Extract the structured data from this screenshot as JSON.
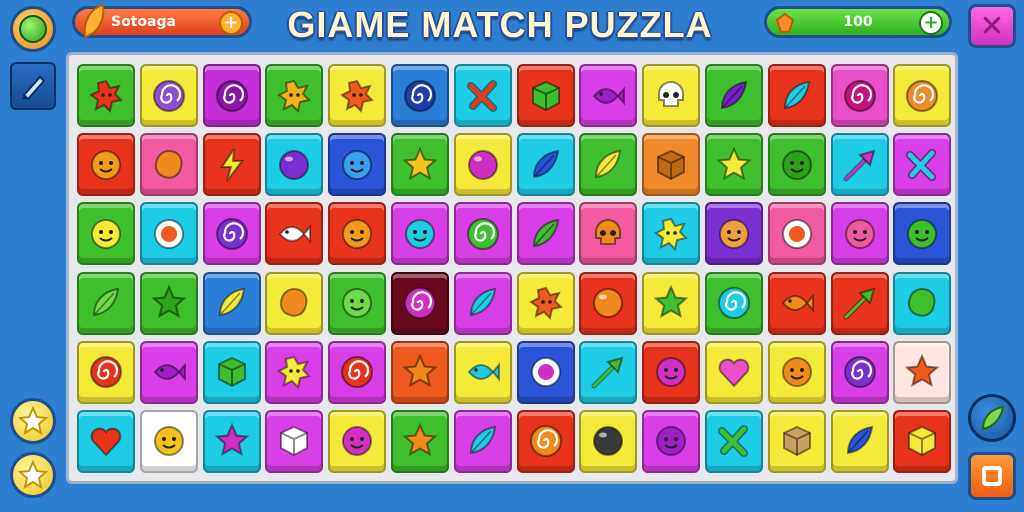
{
  "header": {
    "title": "GIAME MATCH PUZZLA",
    "score_label": "Sotoaga",
    "coins_value": "100",
    "plus_symbol": "+",
    "close_symbol": "✕"
  },
  "colors": {
    "background": "#2f7fd0",
    "board": "#e6e8ec"
  },
  "board": {
    "rows": [
      [
        {
          "bg": "#3fbf2e",
          "icon": "red-splat",
          "fg": "#e8331c"
        },
        {
          "bg": "#f4ea3a",
          "icon": "swirl",
          "fg": "#8d4fd1"
        },
        {
          "bg": "#c42fd8",
          "icon": "swirl",
          "fg": "#8b15a8"
        },
        {
          "bg": "#3fbf2e",
          "icon": "splat",
          "fg": "#f3b01c"
        },
        {
          "bg": "#f4ea3a",
          "icon": "splat",
          "fg": "#ef5a1e"
        },
        {
          "bg": "#2b7fd8",
          "icon": "swirl",
          "fg": "#1d3fa8"
        },
        {
          "bg": "#1ecce6",
          "icon": "cross",
          "fg": "#e23b1c"
        },
        {
          "bg": "#e8331c",
          "icon": "cube",
          "fg": "#3cbf2e"
        },
        {
          "bg": "#d93fe6",
          "icon": "fish",
          "fg": "#a020c8"
        },
        {
          "bg": "#f4ea3a",
          "icon": "skull",
          "fg": "#ffffff"
        },
        {
          "bg": "#3fbf2e",
          "icon": "leaf",
          "fg": "#7b22c6"
        },
        {
          "bg": "#e8331c",
          "icon": "leaf",
          "fg": "#1ecce6"
        },
        {
          "bg": "#e84fc8",
          "icon": "swirl",
          "fg": "#c2127e"
        },
        {
          "bg": "#f4ea3a",
          "icon": "swirl",
          "fg": "#ef8a2a"
        }
      ],
      [
        {
          "bg": "#e8331c",
          "icon": "face",
          "fg": "#f39a1c"
        },
        {
          "bg": "#f15a9e",
          "icon": "blob",
          "fg": "#f08a1c"
        },
        {
          "bg": "#e8331c",
          "icon": "bolt",
          "fg": "#f4ea3a"
        },
        {
          "bg": "#1ecce6",
          "icon": "orb",
          "fg": "#7a2fd0"
        },
        {
          "bg": "#2b55d8",
          "icon": "face",
          "fg": "#3aa0f0"
        },
        {
          "bg": "#3fbf2e",
          "icon": "star",
          "fg": "#f4c21c"
        },
        {
          "bg": "#f4ea3a",
          "icon": "orb",
          "fg": "#d02fc2"
        },
        {
          "bg": "#1ecce6",
          "icon": "leaf",
          "fg": "#2b55d8"
        },
        {
          "bg": "#3fbf2e",
          "icon": "leaf",
          "fg": "#f4ea3a"
        },
        {
          "bg": "#ef8a2a",
          "icon": "cube",
          "fg": "#c06a14"
        },
        {
          "bg": "#3fbf2e",
          "icon": "star",
          "fg": "#f4ea3a"
        },
        {
          "bg": "#3fbf2e",
          "icon": "face",
          "fg": "#2ea01c"
        },
        {
          "bg": "#1ecce6",
          "icon": "arrow",
          "fg": "#d02fc2"
        },
        {
          "bg": "#d93fe6",
          "icon": "cross",
          "fg": "#1ecce6"
        }
      ],
      [
        {
          "bg": "#3fbf2e",
          "icon": "face",
          "fg": "#f4ea3a"
        },
        {
          "bg": "#1ecce6",
          "icon": "ring",
          "fg": "#ef5a1e"
        },
        {
          "bg": "#d93fe6",
          "icon": "swirl",
          "fg": "#7a2fd0"
        },
        {
          "bg": "#e8331c",
          "icon": "fish",
          "fg": "#ffffff"
        },
        {
          "bg": "#e8331c",
          "icon": "face",
          "fg": "#f39a1c"
        },
        {
          "bg": "#d93fe6",
          "icon": "face",
          "fg": "#1ecce6"
        },
        {
          "bg": "#d93fe6",
          "icon": "swirl",
          "fg": "#3fbf2e"
        },
        {
          "bg": "#d93fe6",
          "icon": "leaf",
          "fg": "#3fbf2e"
        },
        {
          "bg": "#f15a9e",
          "icon": "skull",
          "fg": "#f08a1c"
        },
        {
          "bg": "#1ecce6",
          "icon": "splat",
          "fg": "#f4ea3a"
        },
        {
          "bg": "#7a2fd0",
          "icon": "face",
          "fg": "#f0a040"
        },
        {
          "bg": "#f15a9e",
          "icon": "ring",
          "fg": "#ef5a1e"
        },
        {
          "bg": "#d93fe6",
          "icon": "face",
          "fg": "#f15a9e"
        },
        {
          "bg": "#2b55d8",
          "icon": "face",
          "fg": "#3fbf2e"
        }
      ],
      [
        {
          "bg": "#3fbf2e",
          "icon": "leaf",
          "fg": "#6cd84a"
        },
        {
          "bg": "#3fbf2e",
          "icon": "star",
          "fg": "#2ea01c"
        },
        {
          "bg": "#2b7fd8",
          "icon": "leaf",
          "fg": "#f4ea3a"
        },
        {
          "bg": "#f4ea3a",
          "icon": "blob",
          "fg": "#f08a1c"
        },
        {
          "bg": "#3fbf2e",
          "icon": "face",
          "fg": "#6cd84a"
        },
        {
          "bg": "#6a0a1e",
          "icon": "swirl",
          "fg": "#d02fc2"
        },
        {
          "bg": "#d93fe6",
          "icon": "leaf",
          "fg": "#1ecce6"
        },
        {
          "bg": "#f4ea3a",
          "icon": "splat",
          "fg": "#ef5a1e"
        },
        {
          "bg": "#e8331c",
          "icon": "orb",
          "fg": "#f08a1c"
        },
        {
          "bg": "#f4ea3a",
          "icon": "star",
          "fg": "#3fbf2e"
        },
        {
          "bg": "#3fbf2e",
          "icon": "swirl",
          "fg": "#1ecce6"
        },
        {
          "bg": "#e8331c",
          "icon": "fish",
          "fg": "#f08a1c"
        },
        {
          "bg": "#e8331c",
          "icon": "arrow",
          "fg": "#3fbf2e"
        },
        {
          "bg": "#1ecce6",
          "icon": "blob",
          "fg": "#3fbf2e"
        }
      ],
      [
        {
          "bg": "#f4ea3a",
          "icon": "swirl",
          "fg": "#e8331c"
        },
        {
          "bg": "#d93fe6",
          "icon": "fish",
          "fg": "#a020c8"
        },
        {
          "bg": "#1ecce6",
          "icon": "cube",
          "fg": "#3fbf2e"
        },
        {
          "bg": "#d93fe6",
          "icon": "splat",
          "fg": "#f4ea3a"
        },
        {
          "bg": "#d93fe6",
          "icon": "swirl",
          "fg": "#e8331c"
        },
        {
          "bg": "#ef5a1e",
          "icon": "star",
          "fg": "#f08a1c"
        },
        {
          "bg": "#f4ea3a",
          "icon": "fish",
          "fg": "#1ecce6"
        },
        {
          "bg": "#2b55d8",
          "icon": "ring",
          "fg": "#d02fc2"
        },
        {
          "bg": "#1ecce6",
          "icon": "arrow",
          "fg": "#3fbf2e"
        },
        {
          "bg": "#e8331c",
          "icon": "face",
          "fg": "#d02fc2"
        },
        {
          "bg": "#f4ea3a",
          "icon": "heart",
          "fg": "#e84fc8"
        },
        {
          "bg": "#f4ea3a",
          "icon": "face",
          "fg": "#f08a1c"
        },
        {
          "bg": "#d93fe6",
          "icon": "swirl",
          "fg": "#7a2fd0"
        },
        {
          "bg": "#ffe6e0",
          "icon": "star",
          "fg": "#ef5a1e"
        }
      ],
      [
        {
          "bg": "#1ecce6",
          "icon": "heart",
          "fg": "#e8331c"
        },
        {
          "bg": "#ffffff",
          "icon": "face",
          "fg": "#f4c21c"
        },
        {
          "bg": "#1ecce6",
          "icon": "star",
          "fg": "#d02fc2"
        },
        {
          "bg": "#d93fe6",
          "icon": "cube",
          "fg": "#ffffff"
        },
        {
          "bg": "#f4ea3a",
          "icon": "face",
          "fg": "#d02fc2"
        },
        {
          "bg": "#3fbf2e",
          "icon": "star",
          "fg": "#f08a1c"
        },
        {
          "bg": "#d93fe6",
          "icon": "leaf",
          "fg": "#1ecce6"
        },
        {
          "bg": "#e8331c",
          "icon": "swirl",
          "fg": "#f08a1c"
        },
        {
          "bg": "#f4ea3a",
          "icon": "orb",
          "fg": "#3a3a3a"
        },
        {
          "bg": "#d93fe6",
          "icon": "face",
          "fg": "#a020c8"
        },
        {
          "bg": "#1ecce6",
          "icon": "cross",
          "fg": "#3fbf2e"
        },
        {
          "bg": "#f4ea3a",
          "icon": "cube",
          "fg": "#c8a060"
        },
        {
          "bg": "#f4ea3a",
          "icon": "leaf",
          "fg": "#2b55d8"
        },
        {
          "bg": "#e8331c",
          "icon": "cube",
          "fg": "#f4ea3a"
        }
      ]
    ]
  }
}
